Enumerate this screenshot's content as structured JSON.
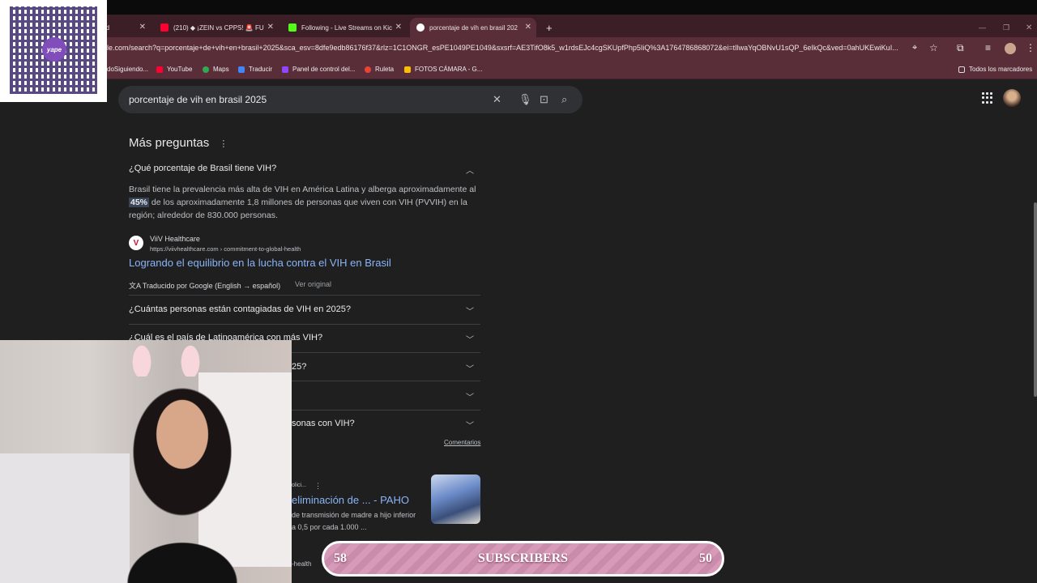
{
  "tabs": [
    {
      "label": "rd",
      "active": false
    },
    {
      "label": "(210) ◆ ¡ZEIN vs CPPS! 🚨 FU",
      "active": false
    },
    {
      "label": "Following - Live Streams on Kic",
      "active": false
    },
    {
      "label": "porcentaje de vih en brasil 202",
      "active": true
    }
  ],
  "new_tab": "+",
  "url": "le.com/search?q=porcentaje+de+vih+en+brasil+2025&sca_esv=8dfe9edb86176f37&rlz=1C1ONGR_esPE1049PE1049&sxsrf=AE3TifO8k5_w1rdsEJc4cgSKUpfPhp5IiQ%3A1764786868072&ei=tIlwaYqOBNvU1sQP_6eIkQc&ved=0ahUKEwiKuI...",
  "bookmarks": [
    "doSiguiendo...",
    "YouTube",
    "Maps",
    "Traducir",
    "Panel de control del...",
    "Ruleta",
    "FOTOS CÁMARA - G..."
  ],
  "bookmarks_folder": "Todos los marcadores",
  "search": {
    "query": "porcentaje de vih en brasil 2025"
  },
  "more_questions": {
    "heading": "Más preguntas",
    "menu": "⋮"
  },
  "questions": [
    "¿Qué porcentaje de Brasil tiene VIH?",
    "¿Cuántas personas están contagiadas de VIH en 2025?",
    "¿Cuál es el país de Latinoamérica con más VIH?",
    "25?",
    "",
    "sonas con VIH?"
  ],
  "answer": {
    "part1": "Brasil tiene la prevalencia más alta de VIH en América Latina y alberga aproximadamente al ",
    "highlight": "45%",
    "part2": " de los aproximadamente 1,8 millones de personas que viven con VIH (PVVIH) en la región; alrededor de 830.000 personas."
  },
  "source": {
    "name": "ViiV Healthcare",
    "url": "https://viivhealthcare.com › commitment-to-global-health",
    "title": "Logrando el equilibrio en la lucha contra el VIH en Brasil",
    "logo": "V"
  },
  "translated": "Traducido por Google (English → español)",
  "view_original": "Ver original",
  "comments": "Comentarios",
  "result2": {
    "meta": "olici...",
    "title": "eliminación de ... - PAHO",
    "snippet1": "de transmisión de madre a hijo inferior",
    "snippet2": "a 0,5 por cada 1.000 ...",
    "footer": "-health"
  },
  "overlay": {
    "qr_brand": "yape",
    "sub_left": "58",
    "sub_label": "SUBSCRIBERS",
    "sub_right": "50"
  }
}
